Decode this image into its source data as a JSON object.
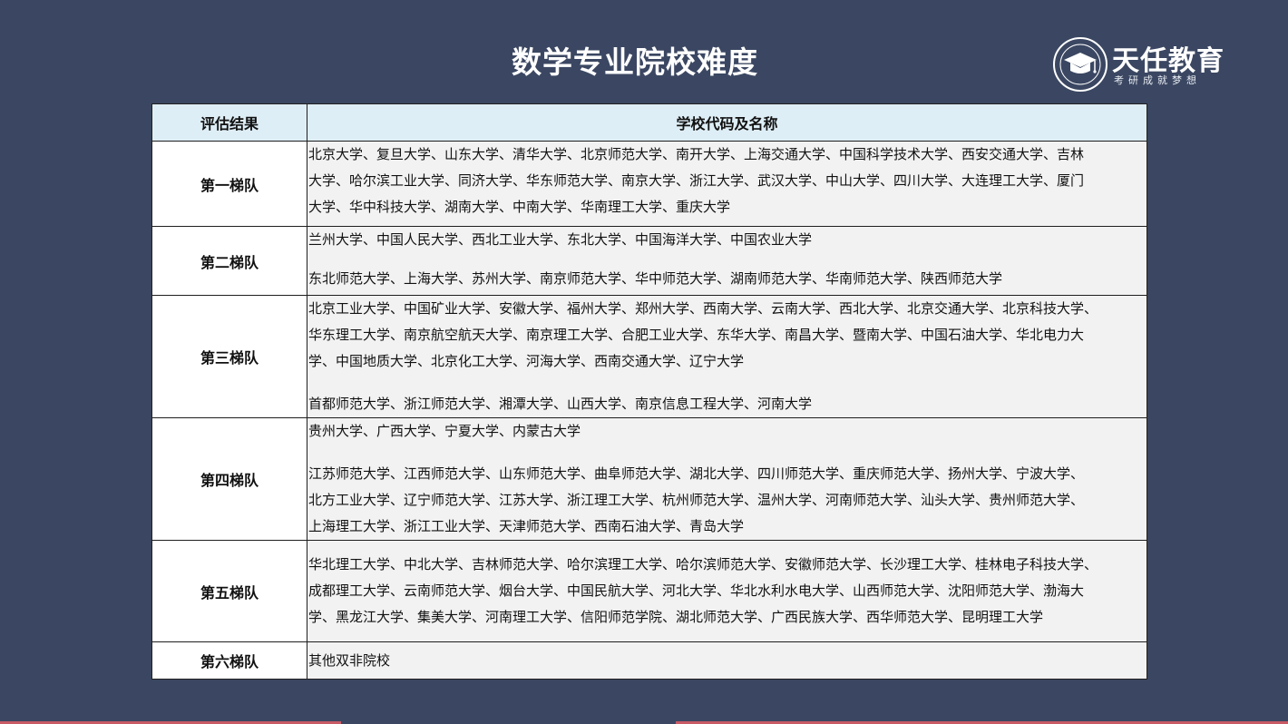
{
  "header": {
    "title": "数学专业院校难度"
  },
  "logo": {
    "name": "天任教育",
    "tagline": "考研成就梦想",
    "emblem_icon": "graduation-cap-icon"
  },
  "table": {
    "headers": [
      "评估结果",
      "学校代码及名称"
    ],
    "rows": [
      {
        "tier": "第一梯队",
        "lines": [
          "北京大学、复旦大学、山东大学、清华大学、北京师范大学、南开大学、上海交通大学、中国科学技术大学、西安交通大学、吉林",
          "大学、哈尔滨工业大学、同济大学、华东师范大学、南京大学、浙江大学、武汉大学、中山大学、四川大学、大连理工大学、厦门",
          "大学、华中科技大学、湖南大学、中南大学、华南理工大学、重庆大学"
        ]
      },
      {
        "tier": "第二梯队",
        "lines": [
          "兰州大学、中国人民大学、西北工业大学、东北大学、中国海洋大学、中国农业大学",
          "东北师范大学、上海大学、苏州大学、南京师范大学、华中师范大学、湖南师范大学、华南师范大学、陕西师范大学"
        ]
      },
      {
        "tier": "第三梯队",
        "lines": [
          "北京工业大学、中国矿业大学、安徽大学、福州大学、郑州大学、西南大学、云南大学、西北大学、北京交通大学、北京科技大学、",
          "华东理工大学、南京航空航天大学、南京理工大学、合肥工业大学、东华大学、南昌大学、暨南大学、中国石油大学、华北电力大",
          "学、中国地质大学、北京化工大学、河海大学、西南交通大学、辽宁大学",
          "首都师范大学、浙江师范大学、湘潭大学、山西大学、南京信息工程大学、河南大学"
        ]
      },
      {
        "tier": "第四梯队",
        "lines": [
          "贵州大学、广西大学、宁夏大学、内蒙古大学",
          "江苏师范大学、江西师范大学、山东师范大学、曲阜师范大学、湖北大学、四川师范大学、重庆师范大学、扬州大学、宁波大学、",
          "北方工业大学、辽宁师范大学、江苏大学、浙江理工大学、杭州师范大学、温州大学、河南师范大学、汕头大学、贵州师范大学、",
          "上海理工大学、浙江工业大学、天津师范大学、西南石油大学、青岛大学"
        ]
      },
      {
        "tier": "第五梯队",
        "lines": [
          "华北理工大学、中北大学、吉林师范大学、哈尔滨理工大学、哈尔滨师范大学、安徽师范大学、长沙理工大学、桂林电子科技大学、",
          "成都理工大学、云南师范大学、烟台大学、中国民航大学、河北大学、华北水利水电大学、山西师范大学、沈阳师范大学、渤海大",
          "学、黑龙江大学、集美大学、河南理工大学、信阳师范学院、湖北师范大学、广西民族大学、西华师范大学、昆明理工大学"
        ]
      },
      {
        "tier": "第六梯队",
        "lines": [
          "其他双非院校"
        ]
      }
    ]
  },
  "colors": {
    "background": "#3b4762",
    "header_row": "#deeef6",
    "cell": "#f2f2f2",
    "accent_strip": "#c85a66"
  }
}
